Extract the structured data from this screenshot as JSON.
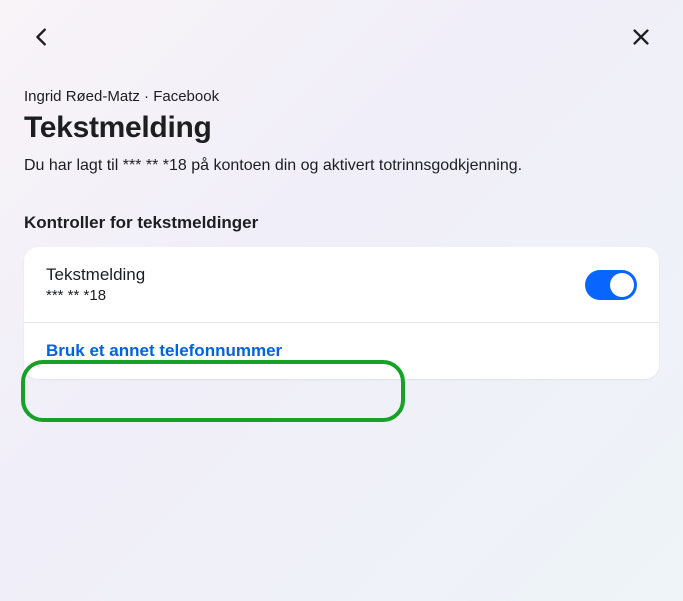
{
  "breadcrumb": "Ingrid Røed-Matz · Facebook",
  "title": "Tekstmelding",
  "subtitle": "Du har lagt til *** ** *18 på kontoen din og aktivert totrinnsgodkjenning.",
  "section_heading": "Kontroller for tekstmeldinger",
  "sms_row": {
    "label": "Tekstmelding",
    "masked_number": "*** ** *18",
    "toggle_on": true
  },
  "link_row": {
    "label": "Bruk et annet telefonnummer"
  },
  "colors": {
    "accent": "#0866ff",
    "link": "#0064e0",
    "highlight": "#17a126"
  }
}
